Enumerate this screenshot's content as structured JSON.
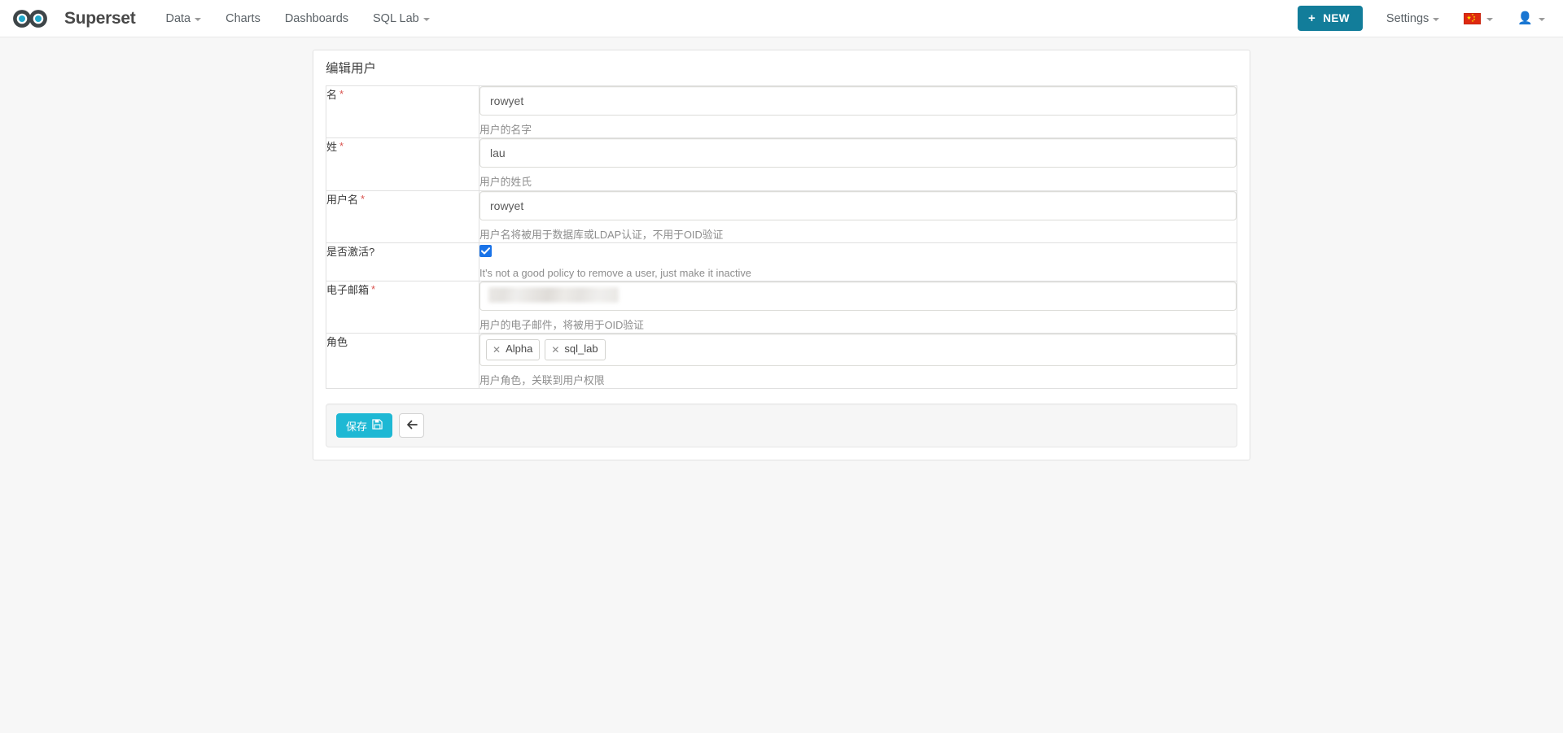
{
  "navbar": {
    "brand": "Superset",
    "links": [
      {
        "label": "Data",
        "has_caret": true
      },
      {
        "label": "Charts",
        "has_caret": false
      },
      {
        "label": "Dashboards",
        "has_caret": false
      },
      {
        "label": "SQL Lab",
        "has_caret": true
      }
    ],
    "new_button": {
      "label": "NEW",
      "icon": "plus-icon",
      "color": "#127d9a"
    },
    "settings": {
      "label": "Settings",
      "has_caret": true
    },
    "language": {
      "icon": "china-flag-icon",
      "has_caret": true
    },
    "user": {
      "icon": "user-avatar-icon",
      "has_caret": true
    }
  },
  "panel": {
    "title": "编辑用户"
  },
  "form": {
    "fields": [
      {
        "label": "名",
        "required": true,
        "type": "text",
        "value": "rowyet",
        "help": "用户的名字"
      },
      {
        "label": "姓",
        "required": true,
        "type": "text",
        "value": "lau",
        "help": "用户的姓氏"
      },
      {
        "label": "用户名",
        "required": true,
        "type": "text",
        "value": "rowyet",
        "help": "用户名将被用于数据库或LDAP认证，不用于OID验证"
      },
      {
        "label": "是否激活?",
        "required": false,
        "type": "checkbox",
        "checked": true,
        "help": "It's not a good policy to remove a user, just make it inactive"
      },
      {
        "label": "电子邮箱",
        "required": true,
        "type": "redacted",
        "value": "",
        "help": "用户的电子邮件，将被用于OID验证"
      },
      {
        "label": "角色",
        "required": false,
        "type": "tags",
        "tags": [
          "Alpha",
          "sql_lab"
        ],
        "help": "用户角色，关联到用户权限"
      }
    ]
  },
  "footer": {
    "save_label": "保存",
    "save_icon": "floppy-disk-icon",
    "back_icon": "arrow-left-icon",
    "save_color": "#1eb8d4"
  }
}
